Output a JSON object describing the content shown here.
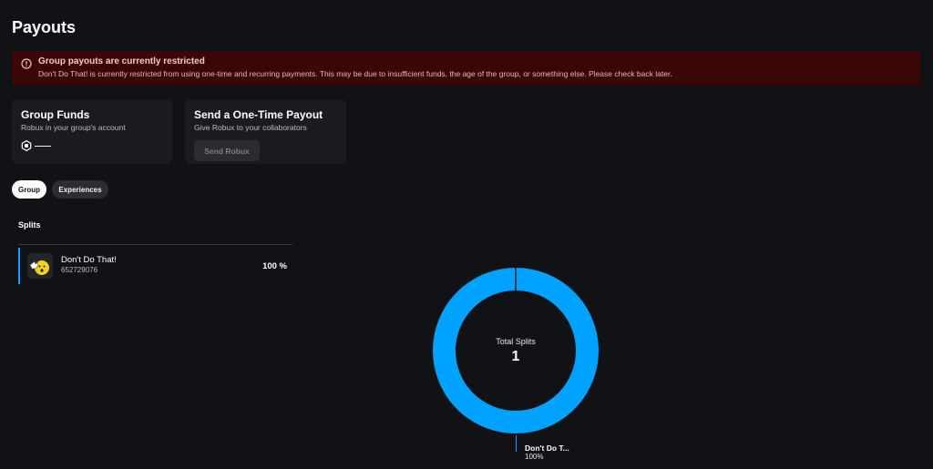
{
  "page": {
    "title": "Payouts"
  },
  "alert": {
    "icon": "alert-circle-icon",
    "title": "Group payouts are currently restricted",
    "body": "Don't Do That! is currently restricted from using one-time and recurring payments. This may be due to insufficient funds, the age of the group, or something else. Please check back later."
  },
  "group_funds": {
    "title": "Group Funds",
    "subtitle": "Robux in your group's account",
    "icon": "robux-icon",
    "value": "——"
  },
  "one_time_payout": {
    "title": "Send a One-Time Payout",
    "subtitle": "Give Robux to your collaborators",
    "button_label": "Send Robux"
  },
  "tabs": [
    {
      "label": "Group",
      "selected": true
    },
    {
      "label": "Experiences",
      "selected": false
    }
  ],
  "splits": {
    "title": "Splits",
    "items": [
      {
        "name": "Don't Do That!",
        "id": "652729076",
        "percent": "100 %"
      }
    ]
  },
  "donut": {
    "label": "Total Splits",
    "count": "1",
    "legend_name": "Don't Do T...",
    "legend_percent": "100%",
    "share": 1.0,
    "color": "#00a2ff"
  }
}
